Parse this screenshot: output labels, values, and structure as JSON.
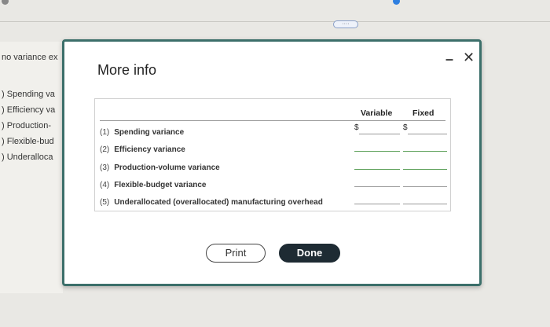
{
  "background": {
    "partial_heading": "no variance ex",
    "items": [
      "Spending va",
      "Efficiency va",
      "Production-",
      "Flexible-bud",
      "Underalloca"
    ],
    "item_prefixes": [
      ")",
      ")",
      ")",
      ")",
      ")"
    ],
    "handle_glyph": "····"
  },
  "modal": {
    "title": "More info",
    "minimize_glyph": "–",
    "close_glyph": "✕",
    "table": {
      "columns": [
        "Variable",
        "Fixed"
      ],
      "currency": "$",
      "rows": [
        {
          "num": "(1)",
          "label": "Spending variance"
        },
        {
          "num": "(2)",
          "label": "Efficiency variance"
        },
        {
          "num": "(3)",
          "label": "Production-volume variance"
        },
        {
          "num": "(4)",
          "label": "Flexible-budget variance"
        },
        {
          "num": "(5)",
          "label": "Underallocated (overallocated) manufacturing overhead"
        }
      ]
    },
    "buttons": {
      "print": "Print",
      "done": "Done"
    }
  }
}
